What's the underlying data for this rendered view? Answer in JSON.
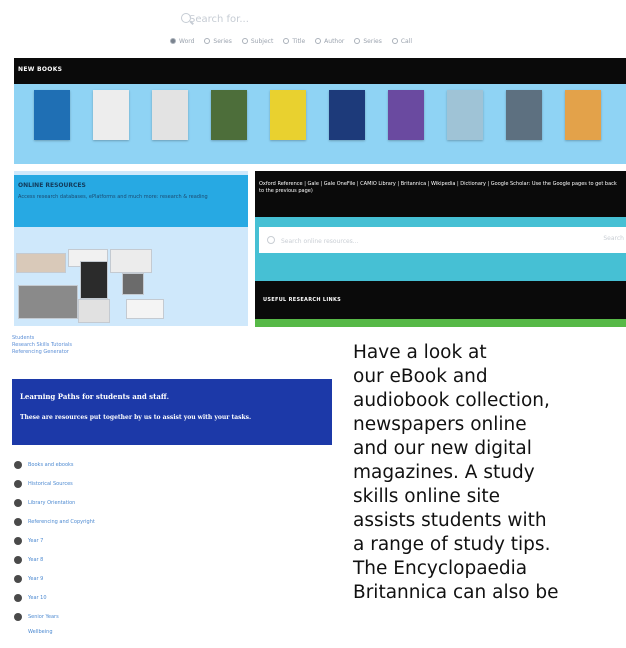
{
  "top": {
    "search_placeholder": "Search for...",
    "filters": [
      {
        "label": "Word",
        "selected": true
      },
      {
        "label": "Series",
        "selected": false
      },
      {
        "label": "Subject",
        "selected": false
      },
      {
        "label": "Title",
        "selected": false
      },
      {
        "label": "Author",
        "selected": false
      },
      {
        "label": "Series",
        "selected": false
      },
      {
        "label": "Call",
        "selected": false
      }
    ]
  },
  "new_books": {
    "title": "NEW BOOKS",
    "covers": [
      {
        "color": "#1f6fb4"
      },
      {
        "color": "#ededed"
      },
      {
        "color": "#e3e3e3"
      },
      {
        "color": "#4d6e3a"
      },
      {
        "color": "#e9d12f"
      },
      {
        "color": "#1d3a7a"
      },
      {
        "color": "#6a4aa0"
      },
      {
        "color": "#9fc3d6"
      },
      {
        "color": "#5d7080"
      },
      {
        "color": "#e3a24a"
      }
    ]
  },
  "online_resources": {
    "title": "ONLINE RESOURCES",
    "description": "Access research databases, ePlatforms and much more: research & reading"
  },
  "right_panel": {
    "links_text": "Oxford Reference | Gale | Gale OneFile | CAMIO Library | Britannica | Wikipedia | Dictionary | Google Scholar: Use the Google pages to get back to the previous page)",
    "search_placeholder": "Search online resources...",
    "search_button": "Search",
    "useful_title": "USEFUL RESEARCH LINKS"
  },
  "lower": {
    "small_links": [
      "Students",
      "Research Skills Tutorials",
      "Referencing Generator"
    ],
    "paths_title": "Learning Paths for students and staff.",
    "paths_desc": "These are resources put together by us to assist you with your tasks.",
    "path_items": [
      "Books and ebooks",
      "Historical Sources",
      "Library Orientation",
      "Referencing and Copyright",
      "Year 7",
      "Year 8",
      "Year 9",
      "Year 10",
      "Senior Years"
    ],
    "path_sub": "Wellbeing"
  },
  "paragraph": "Have a look at\nour eBook and\naudiobook collection,\nnewspapers online\nand our new digital\nmagazines.  A study\nskills online site\nassists students with\na range of study tips.\nThe Encyclopaedia\nBritannica can also be"
}
